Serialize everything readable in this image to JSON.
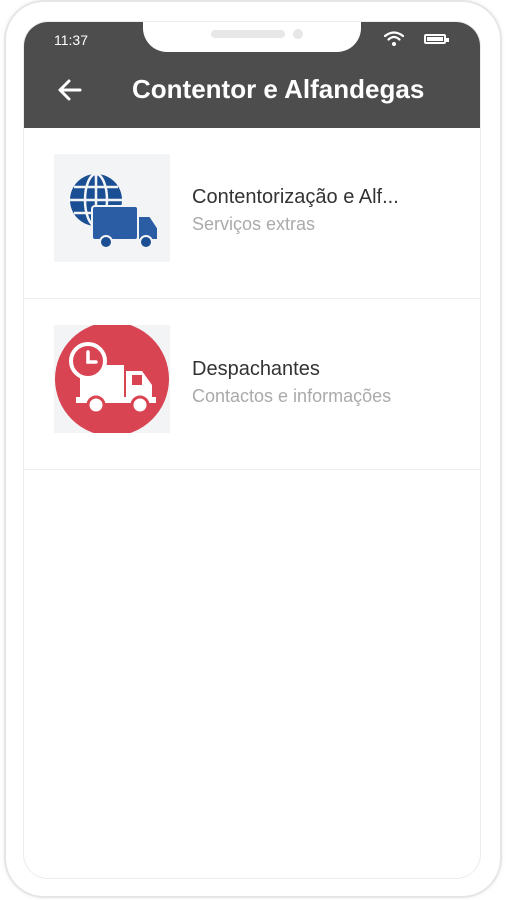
{
  "status_bar": {
    "time": "11:37"
  },
  "header": {
    "title": "Contentor e Alfandegas",
    "back_icon": "arrow-left-icon"
  },
  "items": [
    {
      "title": "Contentorização e Alf...",
      "subtitle": "Serviços extras",
      "icon": "globe-truck-icon",
      "icon_color": "#1a4f93"
    },
    {
      "title": "Despachantes",
      "subtitle": "Contactos e informações",
      "icon": "clock-truck-icon",
      "icon_color": "#d94452"
    }
  ],
  "colors": {
    "header": "#4d4d4d",
    "accent_red": "#d94452",
    "accent_blue": "#1a4f93"
  }
}
